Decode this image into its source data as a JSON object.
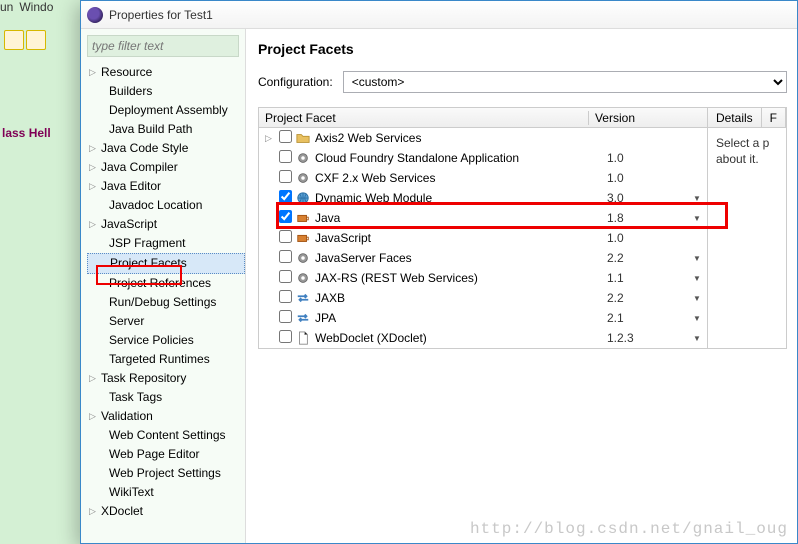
{
  "bg": {
    "menu_run": "un",
    "menu_window": "Windo",
    "code": "lass Hell"
  },
  "dialog": {
    "title": "Properties for Test1"
  },
  "filter": {
    "placeholder": "type filter text"
  },
  "tree": [
    {
      "label": "Resource",
      "arrow": true
    },
    {
      "label": "Builders"
    },
    {
      "label": "Deployment Assembly"
    },
    {
      "label": "Java Build Path"
    },
    {
      "label": "Java Code Style",
      "arrow": true
    },
    {
      "label": "Java Compiler",
      "arrow": true
    },
    {
      "label": "Java Editor",
      "arrow": true
    },
    {
      "label": "Javadoc Location"
    },
    {
      "label": "JavaScript",
      "arrow": true
    },
    {
      "label": "JSP Fragment"
    },
    {
      "label": "Project Facets",
      "sel": true
    },
    {
      "label": "Project References"
    },
    {
      "label": "Run/Debug Settings"
    },
    {
      "label": "Server"
    },
    {
      "label": "Service Policies"
    },
    {
      "label": "Targeted Runtimes"
    },
    {
      "label": "Task Repository",
      "arrow": true
    },
    {
      "label": "Task Tags"
    },
    {
      "label": "Validation",
      "arrow": true
    },
    {
      "label": "Web Content Settings"
    },
    {
      "label": "Web Page Editor"
    },
    {
      "label": "Web Project Settings"
    },
    {
      "label": "WikiText"
    },
    {
      "label": "XDoclet",
      "arrow": true
    }
  ],
  "main": {
    "heading": "Project Facets",
    "config_label": "Configuration:",
    "config_value": "<custom>",
    "col_facet": "Project Facet",
    "col_version": "Version"
  },
  "facets": [
    {
      "name": "Axis2 Web Services",
      "checked": false,
      "ver": "",
      "dd": false,
      "exp": true,
      "icon": "folder"
    },
    {
      "name": "Cloud Foundry Standalone Application",
      "checked": false,
      "ver": "1.0",
      "dd": false,
      "icon": "gear"
    },
    {
      "name": "CXF 2.x Web Services",
      "checked": false,
      "ver": "1.0",
      "dd": false,
      "icon": "gear"
    },
    {
      "name": "Dynamic Web Module",
      "checked": true,
      "ver": "3.0",
      "dd": true,
      "icon": "globe"
    },
    {
      "name": "Java",
      "checked": true,
      "ver": "1.8",
      "dd": true,
      "icon": "java"
    },
    {
      "name": "JavaScript",
      "checked": false,
      "ver": "1.0",
      "dd": false,
      "icon": "java"
    },
    {
      "name": "JavaServer Faces",
      "checked": false,
      "ver": "2.2",
      "dd": true,
      "icon": "gear"
    },
    {
      "name": "JAX-RS (REST Web Services)",
      "checked": false,
      "ver": "1.1",
      "dd": true,
      "icon": "gear"
    },
    {
      "name": "JAXB",
      "checked": false,
      "ver": "2.2",
      "dd": true,
      "icon": "arrows"
    },
    {
      "name": "JPA",
      "checked": false,
      "ver": "2.1",
      "dd": true,
      "icon": "arrows"
    },
    {
      "name": "WebDoclet (XDoclet)",
      "checked": false,
      "ver": "1.2.3",
      "dd": true,
      "icon": "doc"
    }
  ],
  "details": {
    "tab": "Details",
    "body1": "Select a p",
    "body2": "about it."
  },
  "watermark": "http://blog.csdn.net/gnail_oug"
}
